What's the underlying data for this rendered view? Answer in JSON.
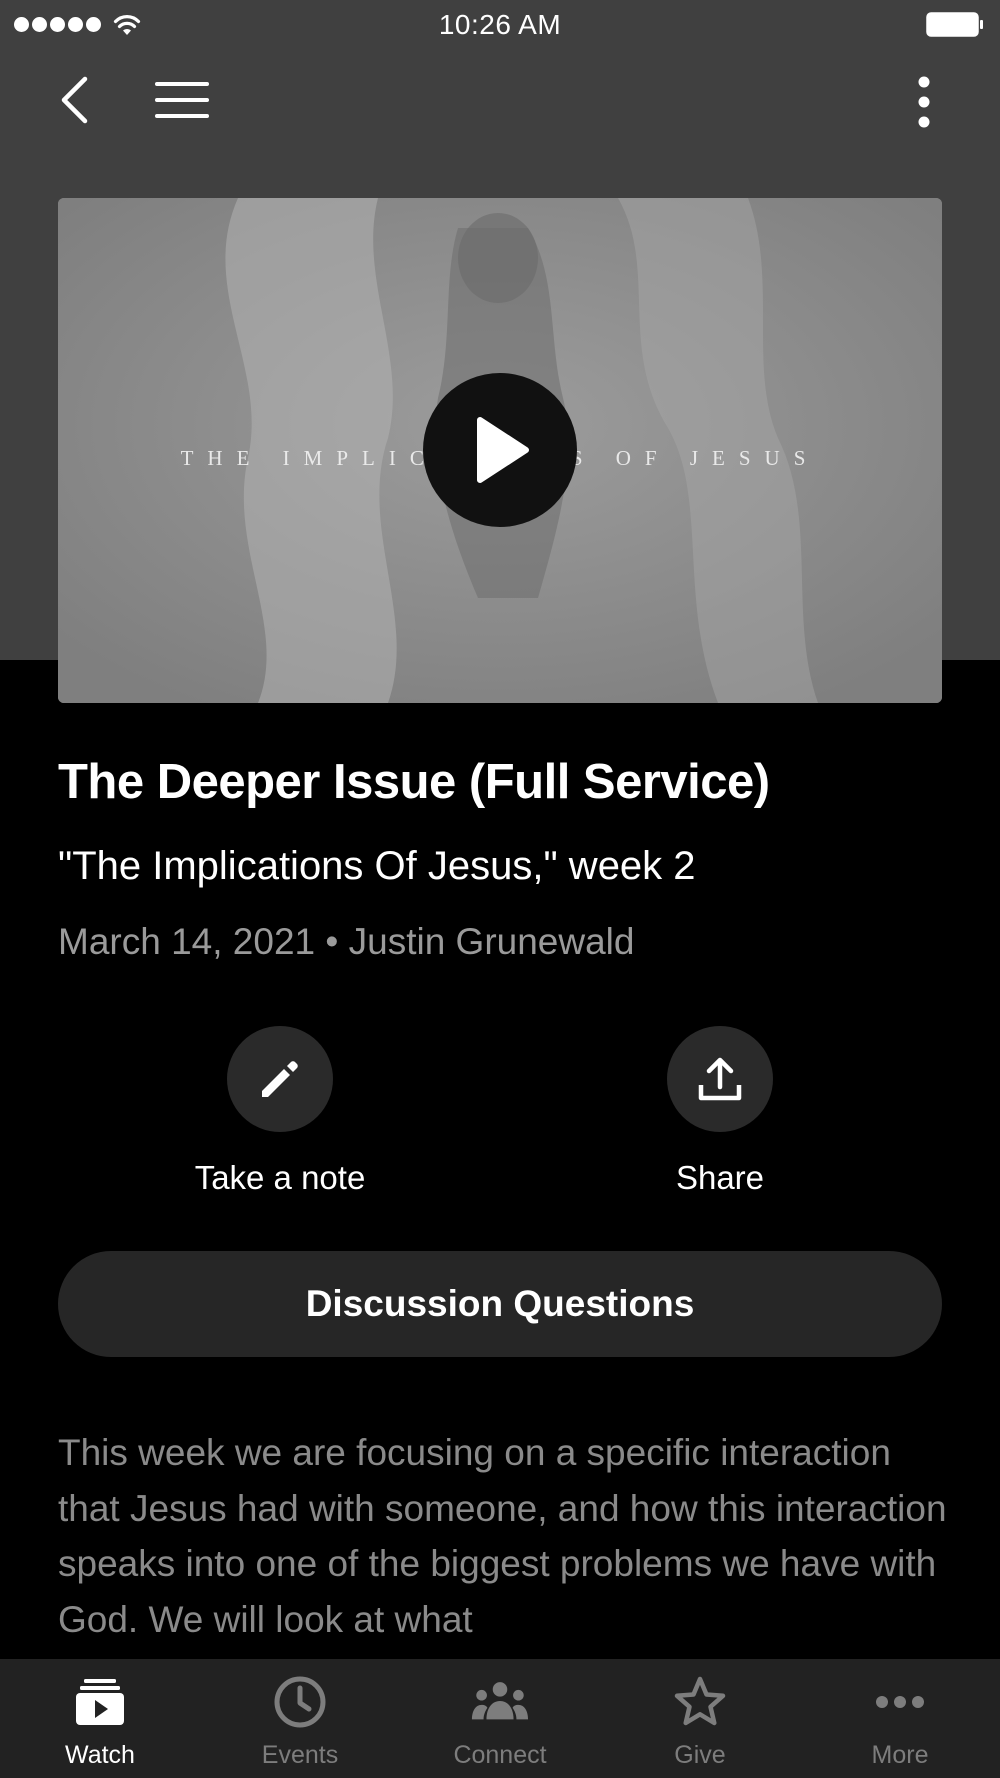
{
  "status_bar": {
    "time": "10:26 AM"
  },
  "video": {
    "overlay_text": "THE IMPLICATIONS OF JESUS"
  },
  "content": {
    "title": "The Deeper Issue (Full Service)",
    "subtitle": "\"The Implications Of Jesus,\" week 2",
    "meta": "March 14, 2021 • Justin Grunewald",
    "description": "This week we are focusing on a specific interaction that Jesus had with someone, and how this interaction speaks into one of the biggest problems we have with God. We will look at what"
  },
  "actions": {
    "note_label": "Take a note",
    "share_label": "Share",
    "discussion_label": "Discussion Questions"
  },
  "tabs": [
    {
      "label": "Watch",
      "icon": "video-library-icon",
      "active": true
    },
    {
      "label": "Events",
      "icon": "clock-icon",
      "active": false
    },
    {
      "label": "Connect",
      "icon": "people-icon",
      "active": false
    },
    {
      "label": "Give",
      "icon": "star-icon",
      "active": false
    },
    {
      "label": "More",
      "icon": "more-dots-icon",
      "active": false
    }
  ],
  "colors": {
    "header_background": "#404040",
    "page_background": "#000000",
    "tab_bar_background": "#222222",
    "active_tab": "#ffffff",
    "inactive_tab": "#7d7d7d"
  }
}
